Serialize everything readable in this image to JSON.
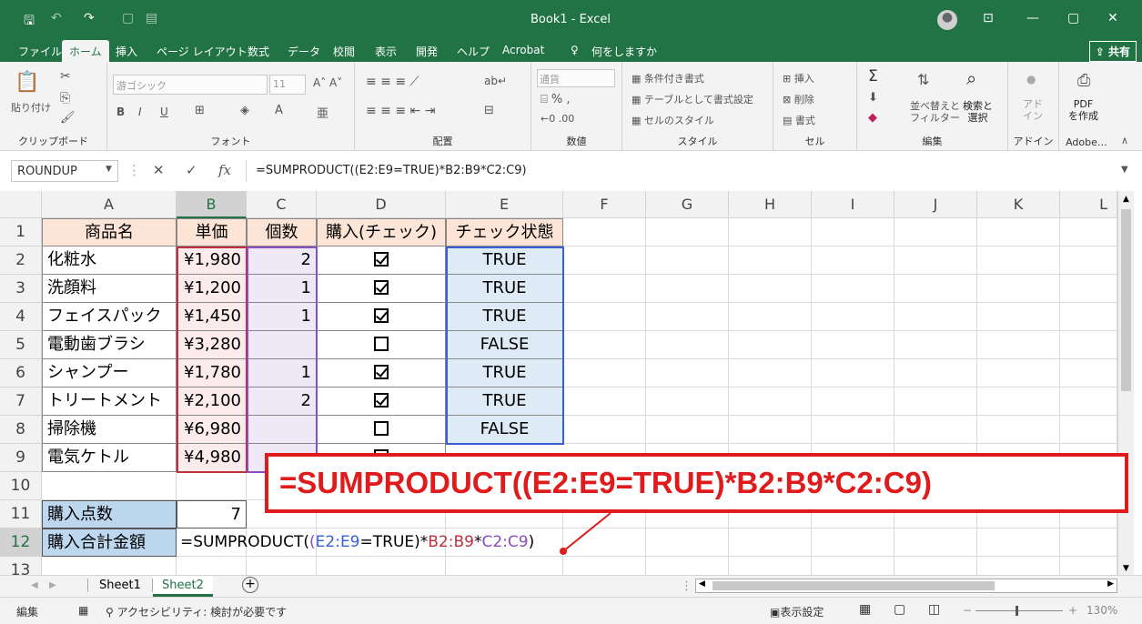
{
  "window": {
    "title": "Book1  -  Excel"
  },
  "ribbon_tabs": [
    "ファイル",
    "ホーム",
    "挿入",
    "ページ レイアウト",
    "数式",
    "データ",
    "校閲",
    "表示",
    "開発",
    "ヘルプ",
    "Acrobat",
    "何をしますか"
  ],
  "share_label": "共有",
  "ribbon": {
    "clipboard": {
      "paste": "貼り付け",
      "label": "クリップボード"
    },
    "font": {
      "name": "游ゴシック",
      "size": "11",
      "label": "フォント"
    },
    "alignment": {
      "label": "配置"
    },
    "number": {
      "format": "通貨",
      "label": "数値"
    },
    "styles": {
      "cond": "条件付き書式",
      "table": "テーブルとして書式設定",
      "cell": "セルのスタイル",
      "label": "スタイル"
    },
    "cells": {
      "insert": "挿入",
      "delete": "削除",
      "format": "書式",
      "label": "セル"
    },
    "editing": {
      "sort": "並べ替えと\nフィルター",
      "find": "検索と\n選択",
      "label": "編集"
    },
    "addin": {
      "btn": "アド\nイン",
      "label": "アドイン"
    },
    "adobe": {
      "btn": "PDF\nを作成",
      "label": "Adobe…"
    }
  },
  "formula_bar": {
    "name_box": "ROUNDUP",
    "formula": "=SUMPRODUCT((E2:E9=TRUE)*B2:B9*C2:C9)"
  },
  "columns": [
    "A",
    "B",
    "C",
    "D",
    "E",
    "F",
    "G",
    "H",
    "I",
    "J",
    "K",
    "L"
  ],
  "rows": [
    "1",
    "2",
    "3",
    "4",
    "5",
    "6",
    "7",
    "8",
    "9",
    "10",
    "11",
    "12",
    "13"
  ],
  "table": {
    "headers": [
      "商品名",
      "単価",
      "個数",
      "購入(チェック)",
      "チェック状態"
    ],
    "items": [
      {
        "name": "化粧水",
        "price": "¥1,980",
        "qty": "2",
        "checked": true,
        "state": "TRUE"
      },
      {
        "name": "洗顔料",
        "price": "¥1,200",
        "qty": "1",
        "checked": true,
        "state": "TRUE"
      },
      {
        "name": "フェイスパック",
        "price": "¥1,450",
        "qty": "1",
        "checked": true,
        "state": "TRUE"
      },
      {
        "name": "電動歯ブラシ",
        "price": "¥3,280",
        "qty": "",
        "checked": false,
        "state": "FALSE"
      },
      {
        "name": "シャンプー",
        "price": "¥1,780",
        "qty": "1",
        "checked": true,
        "state": "TRUE"
      },
      {
        "name": "トリートメント",
        "price": "¥2,100",
        "qty": "2",
        "checked": true,
        "state": "TRUE"
      },
      {
        "name": "掃除機",
        "price": "¥6,980",
        "qty": "",
        "checked": false,
        "state": "FALSE"
      },
      {
        "name": "電気ケトル",
        "price": "¥4,980",
        "qty": "",
        "checked": false,
        "state": ""
      }
    ],
    "count_label": "購入点数",
    "count_value": "7",
    "total_label": "購入合計金額"
  },
  "cell_formula": {
    "p1": "=SUMPRODUCT(",
    "p2": "(",
    "p3": "E2:E9",
    "p4": "=TRUE)*",
    "p5": "B2:B9",
    "p6": "*",
    "p7": "C2:C9",
    "p8": ")"
  },
  "callout": "=SUMPRODUCT((E2:E9=TRUE)*B2:B9*C2:C9)",
  "sheets": [
    "Sheet1",
    "Sheet2"
  ],
  "status": {
    "mode": "編集",
    "accessibility": "アクセシビリティ: 検討が必要です",
    "display": "表示設定",
    "zoom": "130%"
  },
  "colors": {
    "excel_green": "#217346",
    "callout_red": "#e01b1b",
    "header_fill": "#fce4d6",
    "price_fill": "#fcebec",
    "qty_fill": "#efe8f7",
    "state_fill": "#deebf7",
    "total_fill": "#bdd7ee"
  }
}
